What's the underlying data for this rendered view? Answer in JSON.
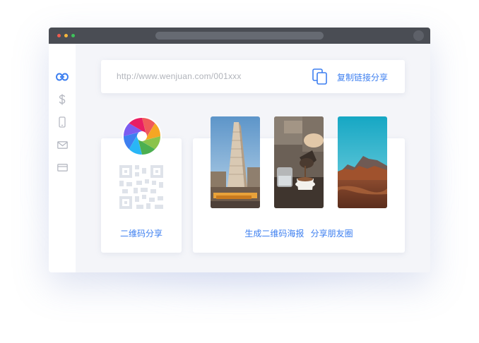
{
  "window": {
    "controls": [
      "close-dot",
      "minimize-dot",
      "maximize-dot"
    ]
  },
  "sidebar": {
    "items": [
      {
        "icon": "link-icon",
        "active": true
      },
      {
        "icon": "dollar-icon",
        "active": false
      },
      {
        "icon": "mobile-icon",
        "active": false
      },
      {
        "icon": "mail-icon",
        "active": false
      },
      {
        "icon": "card-icon",
        "active": false
      }
    ]
  },
  "link_share": {
    "url": "http://www.wenjuan.com/001xxx",
    "copy_label": "复制链接分享",
    "copy_icon": "copy-icon"
  },
  "qr_share": {
    "icon": "aperture-logo-icon",
    "label": "二维码分享"
  },
  "poster_share": {
    "photos": [
      "flatiron-building-photo",
      "coffee-pour-photo",
      "mountain-landscape-photo"
    ],
    "generate_label": "生成二维码海报",
    "moments_label": "分享朋友圈"
  },
  "colors": {
    "accent": "#3d7ff0",
    "titlebar": "#4a4d54",
    "background": "#f4f5f9"
  }
}
